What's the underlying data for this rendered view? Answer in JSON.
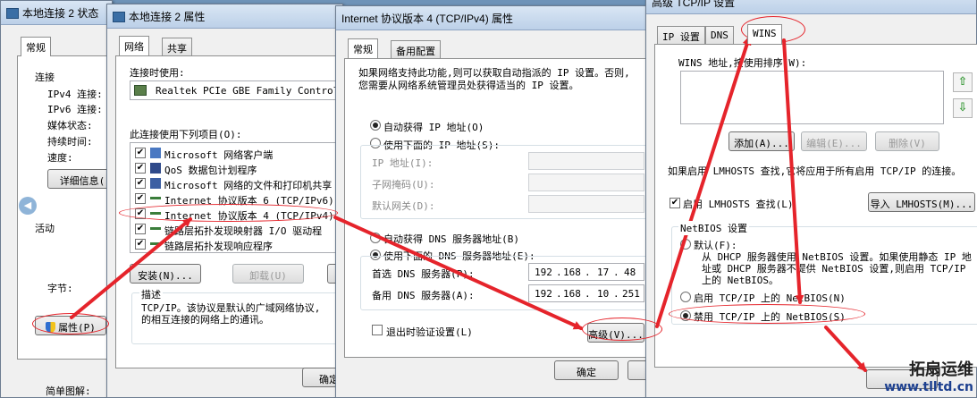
{
  "w1": {
    "title": "本地连接 2 状态",
    "tab": "常规",
    "section_conn": "连接",
    "ipv4": "IPv4 连接:",
    "ipv6": "IPv6 连接:",
    "media": "媒体状态:",
    "duration": "持续时间:",
    "speed": "速度:",
    "details_btn": "详细信息(",
    "section_activity": "活动",
    "bytes": "字节:",
    "props_btn": "属性(P)",
    "bottom_cut": "简单图解:"
  },
  "w2": {
    "title": "本地连接 2 属性",
    "tabs": [
      "网络",
      "共享"
    ],
    "connect_using": "连接时使用:",
    "adapter": "Realtek PCIe GBE Family Controlle",
    "items_label": "此连接使用下列项目(O):",
    "items": [
      "Microsoft 网络客户端",
      "QoS 数据包计划程序",
      "Microsoft 网络的文件和打印机共享",
      "Internet 协议版本 6 (TCP/IPv6)",
      "Internet 协议版本 4 (TCP/IPv4)",
      "链路层拓扑发现映射器 I/O 驱动程",
      "链路层拓扑发现响应程序"
    ],
    "install_btn": "安装(N)...",
    "uninstall_btn": "卸载(U)",
    "desc_label": "描述",
    "desc_text": "TCP/IP。该协议是默认的广域网络协议,\n的相互连接的网络上的通讯。",
    "ok_btn": "确定"
  },
  "w3": {
    "title": "Internet 协议版本 4 (TCP/IPv4) 属性",
    "tabs": [
      "常规",
      "备用配置"
    ],
    "intro": "如果网络支持此功能,则可以获取自动指派的 IP 设置。否则,\n您需要从网络系统管理员处获得适当的 IP 设置。",
    "auto_ip": "自动获得 IP 地址(O)",
    "manual_ip": "使用下面的 IP 地址(S):",
    "ip_addr": "IP 地址(I):",
    "subnet": "子网掩码(U):",
    "gateway": "默认网关(D):",
    "auto_dns": "自动获得 DNS 服务器地址(B)",
    "manual_dns": "使用下面的 DNS 服务器地址(E):",
    "pref_dns": "首选 DNS 服务器(P):",
    "alt_dns": "备用 DNS 服务器(A):",
    "pref_dns_val": [
      "192",
      "168",
      "17",
      "48"
    ],
    "alt_dns_val": [
      "192",
      "168",
      "10",
      "251"
    ],
    "validate": "退出时验证设置(L)",
    "advanced_btn": "高级(V)...",
    "ok_btn": "确定"
  },
  "w4": {
    "title": "高级 TCP/IP 设置",
    "tabs": [
      "IP 设置",
      "DNS",
      "WINS"
    ],
    "wins_label": "WINS 地址,按使用排序(W):",
    "add_btn": "添加(A)...",
    "edit_btn": "编辑(E)...",
    "remove_btn": "删除(V)",
    "lmhosts_note": "如果启用 LMHOSTS 查找,它将应用于所有启用 TCP/IP 的连接。",
    "lmhosts_chk": "启用 LMHOSTS 查找(L)",
    "import_btn": "导入 LMHOSTS(M)...",
    "netbios_label": "NetBIOS 设置",
    "default_opt": "默认(F):",
    "default_desc": "从 DHCP 服务器使用 NetBIOS 设置。如果使用静态 IP 地\n址或 DHCP 服务器不提供 NetBIOS 设置,则启用 TCP/IP\n上的 NetBIOS。",
    "enable_opt": "启用 TCP/IP 上的 NetBIOS(N)",
    "disable_opt": "禁用 TCP/IP 上的 NetBIOS(S)"
  },
  "watermark": {
    "line1": "拓扇运维",
    "line2": "www.tlltd.cn"
  },
  "colors": {
    "annotation": "#e5242b"
  }
}
